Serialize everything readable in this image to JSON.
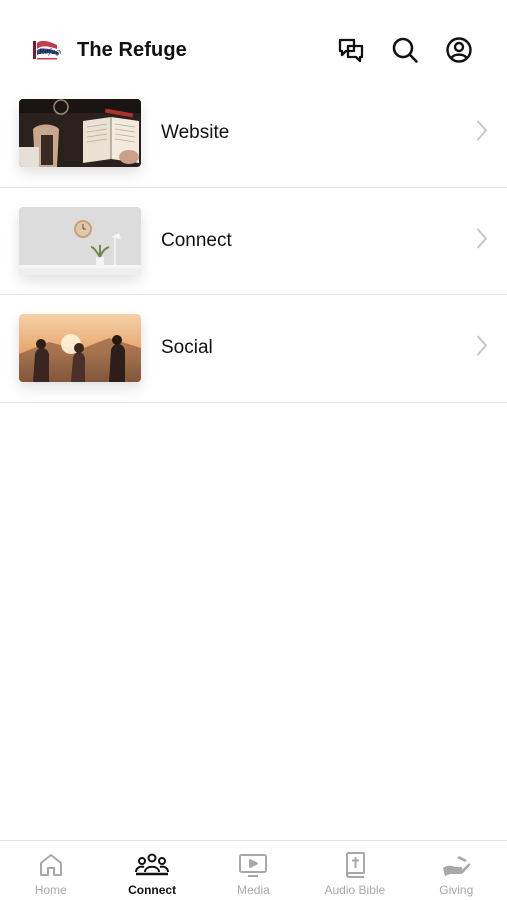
{
  "header": {
    "title": "The Refuge",
    "logo_icon": "refuge-logo",
    "actions": [
      {
        "name": "messages-icon"
      },
      {
        "name": "search-icon"
      },
      {
        "name": "profile-icon"
      }
    ]
  },
  "list": {
    "items": [
      {
        "label": "Website",
        "thumbnail": "bible-open-image"
      },
      {
        "label": "Connect",
        "thumbnail": "wall-clock-image"
      },
      {
        "label": "Social",
        "thumbnail": "friends-sunset-image"
      }
    ]
  },
  "tabbar": {
    "active": "Connect",
    "tabs": [
      {
        "label": "Home",
        "icon": "home-icon"
      },
      {
        "label": "Connect",
        "icon": "people-icon"
      },
      {
        "label": "Media",
        "icon": "tv-play-icon"
      },
      {
        "label": "Audio Bible",
        "icon": "bible-cross-icon"
      },
      {
        "label": "Giving",
        "icon": "giving-hand-icon"
      }
    ]
  },
  "colors": {
    "active": "#111111",
    "inactive": "#a8a8a8",
    "divider": "#e6e6e6"
  }
}
